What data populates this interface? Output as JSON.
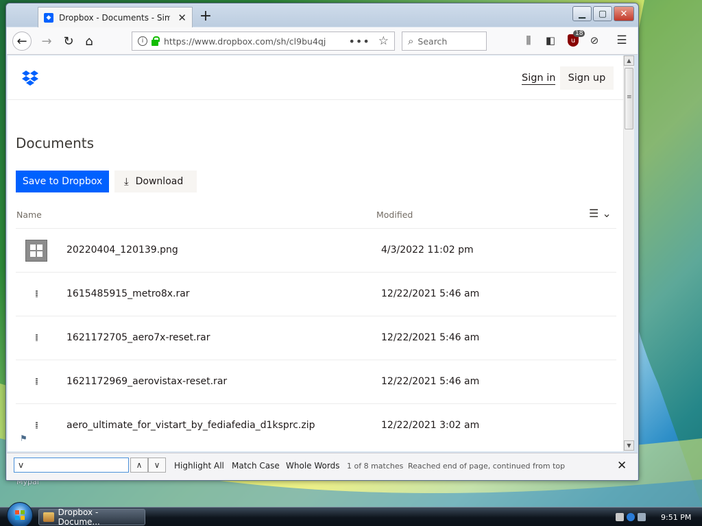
{
  "desktop": {
    "label": "Mypal"
  },
  "browser": {
    "tab": {
      "title": "Dropbox - Documents - Simplif",
      "icon": "dropbox-icon"
    },
    "new_tab": "+",
    "url": "https://www.dropbox.com/sh/cl9bu4qj",
    "search_placeholder": "Search",
    "ublock_badge": "18"
  },
  "page": {
    "sign_in": "Sign in",
    "sign_up": "Sign up",
    "title": "Documents",
    "save_button": "Save to Dropbox",
    "download_button": "Download",
    "columns": {
      "name": "Name",
      "modified": "Modified"
    },
    "files": [
      {
        "name": "20220404_120139.png",
        "modified": "4/3/2022 11:02 pm",
        "type": "image"
      },
      {
        "name": "1615485915_metro8x.rar",
        "modified": "12/22/2021 5:46 am",
        "type": "archive"
      },
      {
        "name": "1621172705_aero7x-reset.rar",
        "modified": "12/22/2021 5:46 am",
        "type": "archive"
      },
      {
        "name": "1621172969_aerovistax-reset.rar",
        "modified": "12/22/2021 5:46 am",
        "type": "archive"
      },
      {
        "name": "aero_ultimate_for_vistart_by_fediafedia_d1ksprc.zip",
        "modified": "12/22/2021 3:02 am",
        "type": "archive"
      }
    ]
  },
  "findbar": {
    "query": "v",
    "highlight_all": "Highlight All",
    "match_case": "Match Case",
    "whole_words": "Whole Words",
    "match_count": "1 of 8 matches",
    "status": "Reached end of page, continued from top"
  },
  "taskbar": {
    "window_label": "Dropbox - Docume...",
    "clock": "9:51 PM"
  },
  "colors": {
    "dropbox_blue": "#0061fe",
    "text": "#1e1919",
    "muted": "#736c64"
  }
}
